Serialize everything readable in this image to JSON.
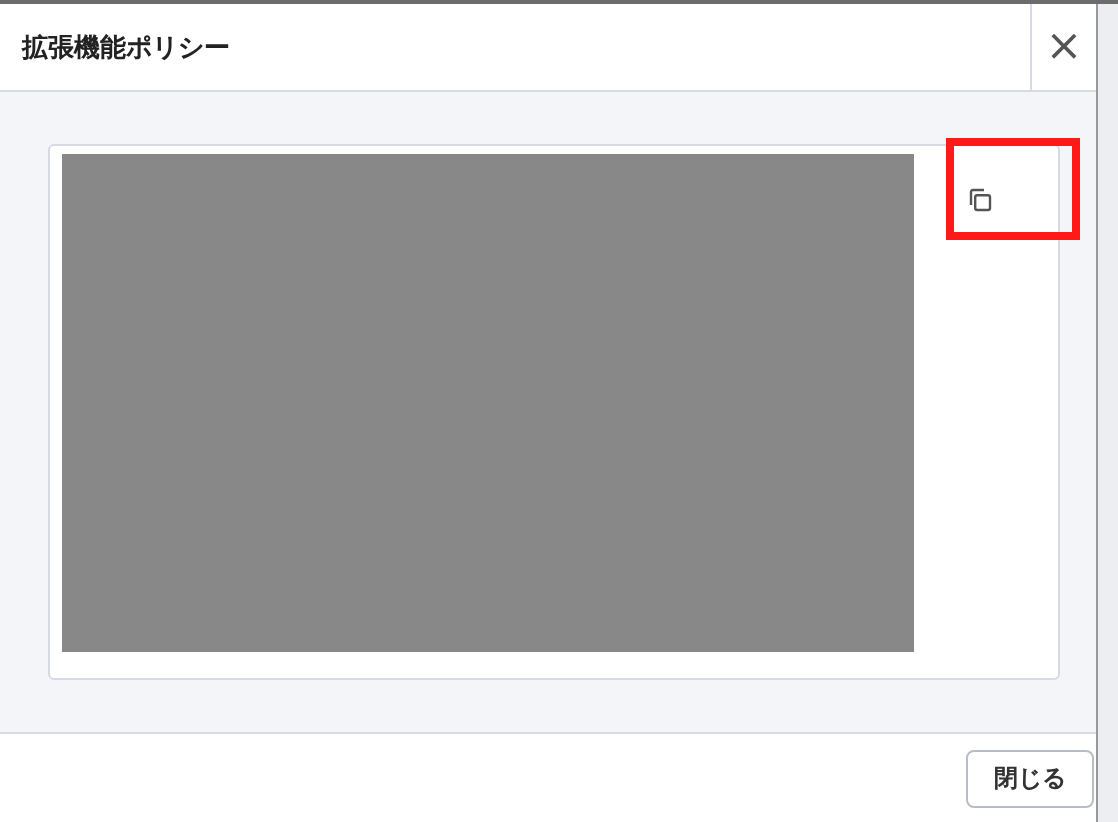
{
  "dialog": {
    "title": "拡張機能ポリシー",
    "close_icon": "×",
    "footer_button": "閉じる"
  }
}
